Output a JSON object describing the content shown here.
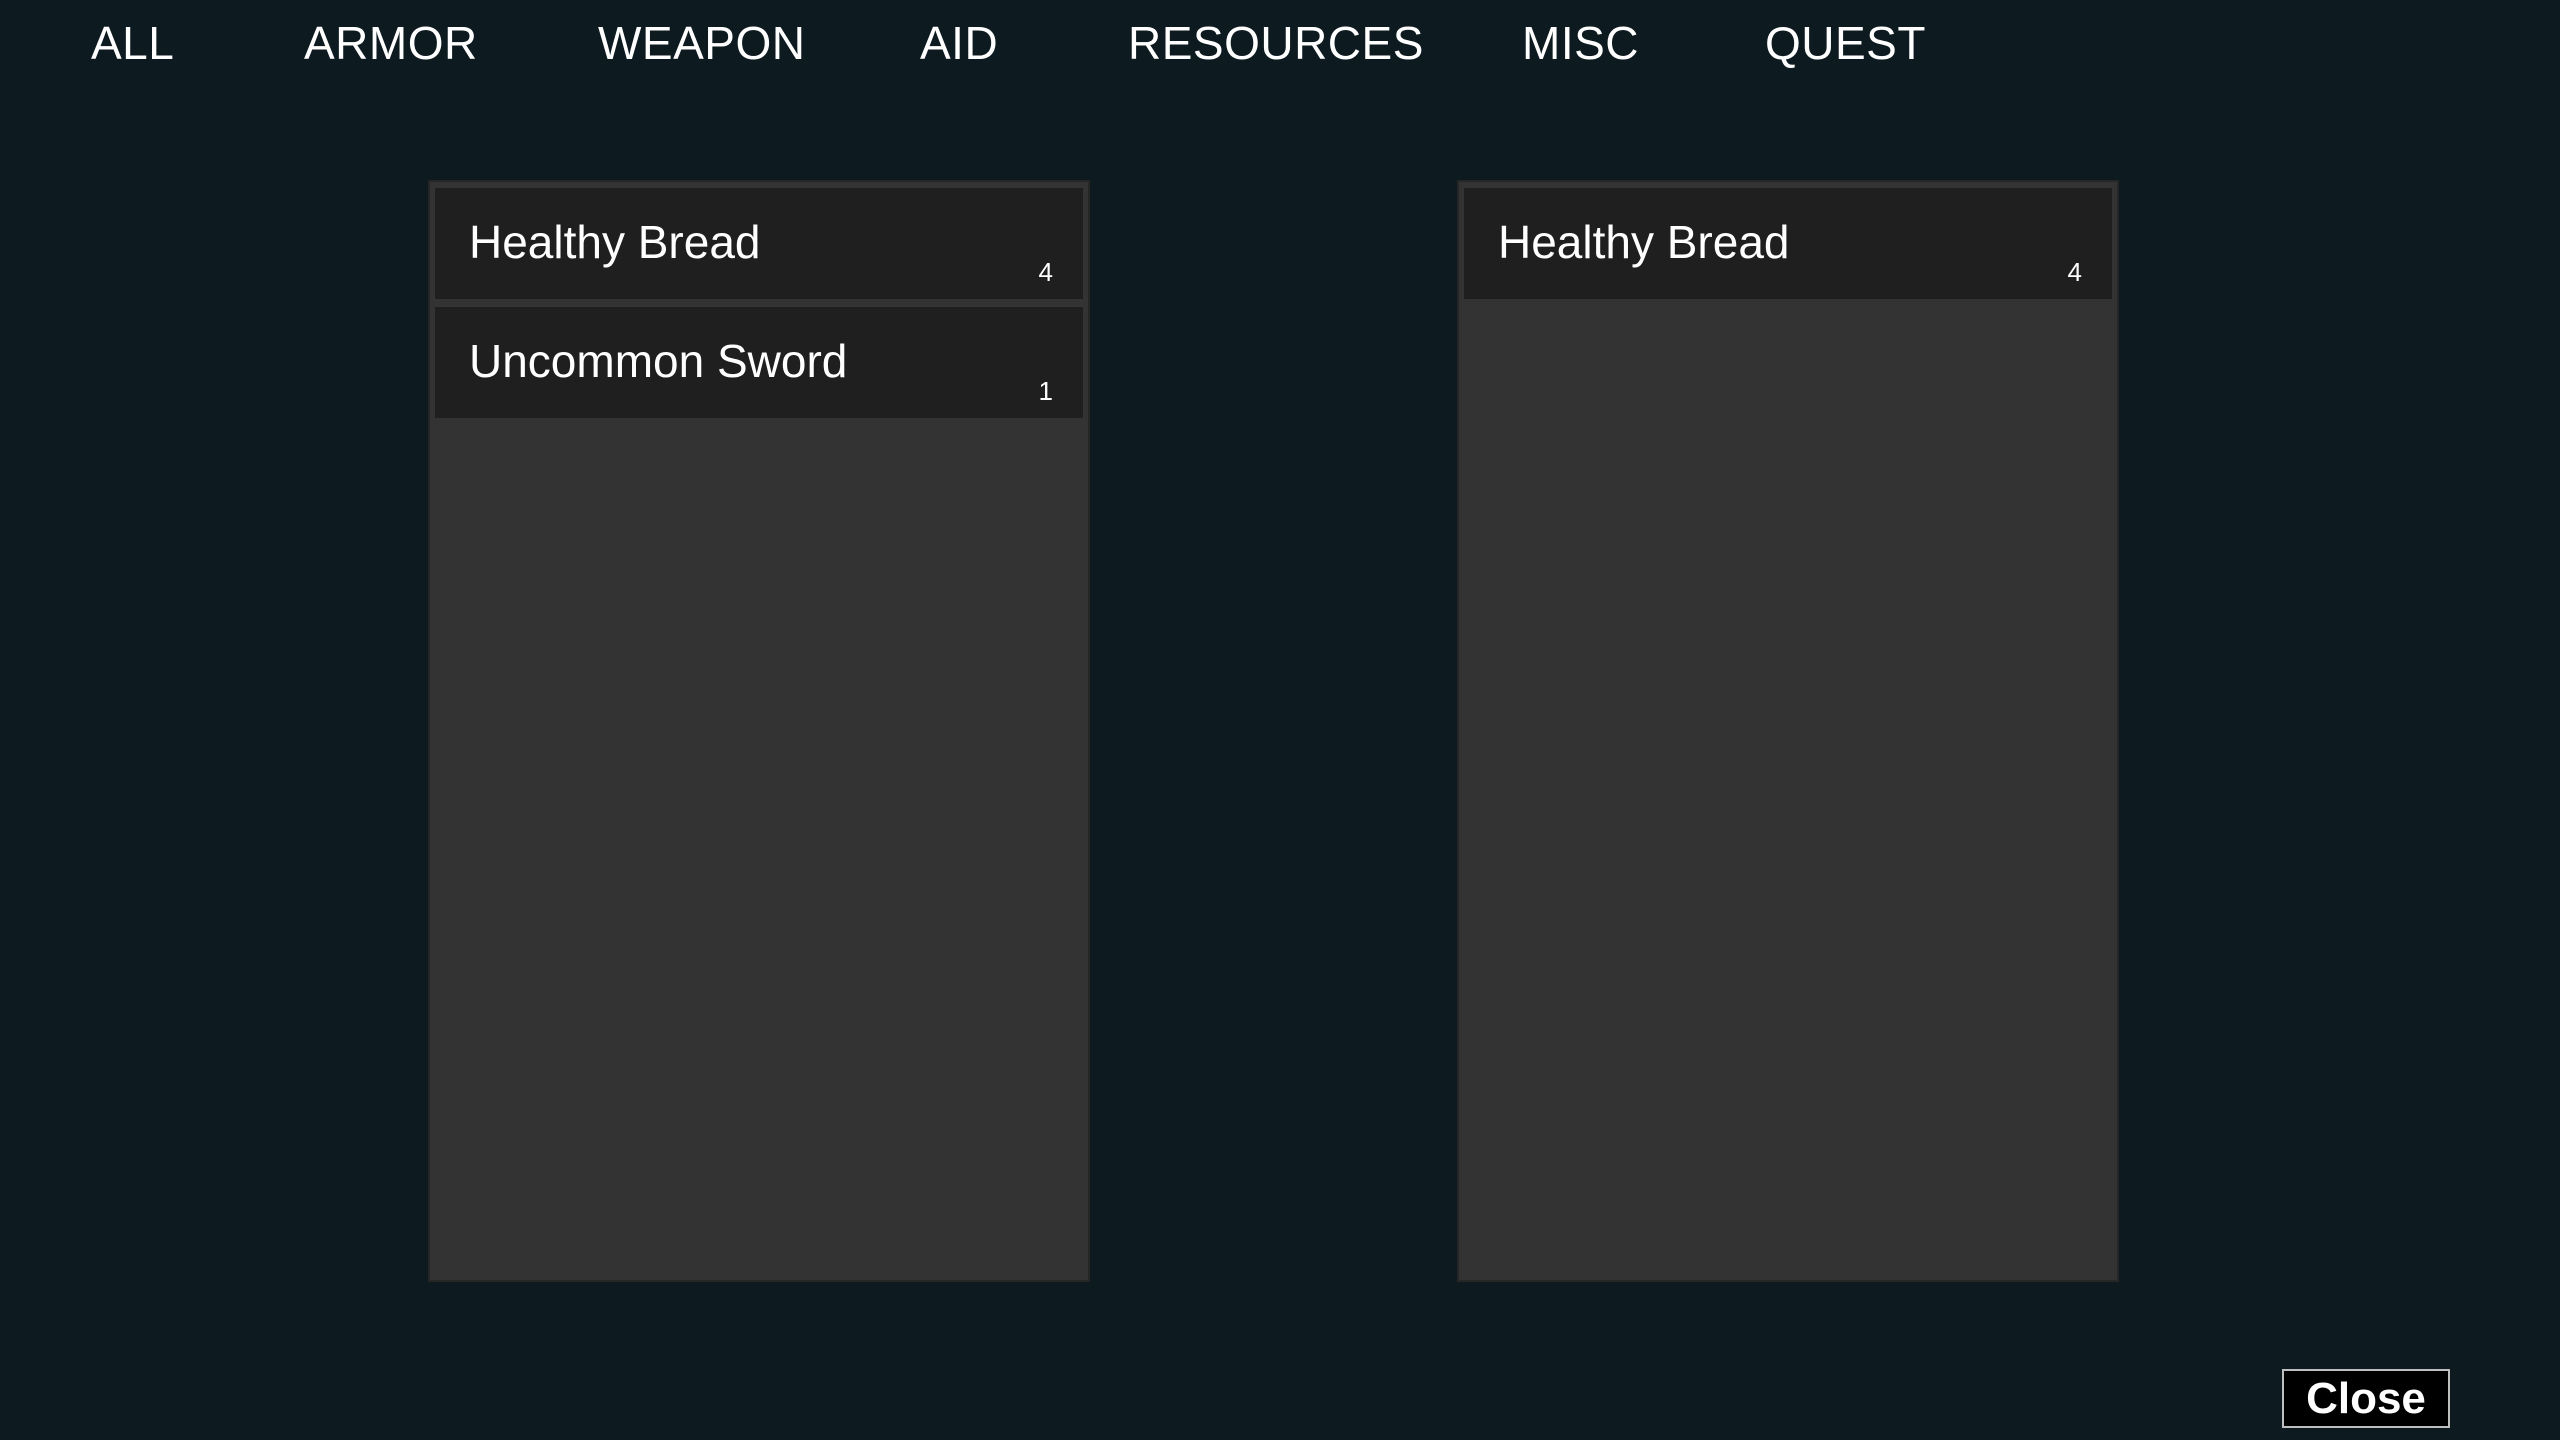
{
  "tabs": [
    {
      "label": "ALL"
    },
    {
      "label": "ARMOR"
    },
    {
      "label": "WEAPON"
    },
    {
      "label": "AID"
    },
    {
      "label": "RESOURCES"
    },
    {
      "label": "MISC"
    },
    {
      "label": "QUEST"
    }
  ],
  "left_panel": {
    "items": [
      {
        "name": "Healthy Bread",
        "count": "4"
      },
      {
        "name": "Uncommon Sword",
        "count": "1"
      }
    ]
  },
  "right_panel": {
    "items": [
      {
        "name": "Healthy Bread",
        "count": "4"
      }
    ]
  },
  "close_label": "Close",
  "colors": {
    "background": "#0d1a1f",
    "panel": "#333333",
    "slot": "#1f1f1f",
    "text": "#ffffff"
  }
}
